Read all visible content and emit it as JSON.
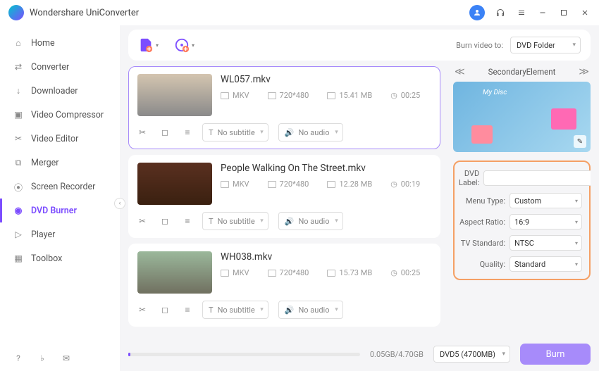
{
  "app": {
    "title": "Wondershare UniConverter"
  },
  "sidebar": {
    "items": [
      {
        "label": "Home",
        "icon": "home"
      },
      {
        "label": "Converter",
        "icon": "converter"
      },
      {
        "label": "Downloader",
        "icon": "download"
      },
      {
        "label": "Video Compressor",
        "icon": "compress"
      },
      {
        "label": "Video Editor",
        "icon": "edit"
      },
      {
        "label": "Merger",
        "icon": "merge"
      },
      {
        "label": "Screen Recorder",
        "icon": "record"
      },
      {
        "label": "DVD Burner",
        "icon": "dvd",
        "active": true
      },
      {
        "label": "Player",
        "icon": "play"
      },
      {
        "label": "Toolbox",
        "icon": "tools"
      }
    ]
  },
  "toolbar": {
    "burn_to_label": "Burn video to:",
    "burn_to_value": "DVD Folder"
  },
  "files": [
    {
      "name": "WL057.mkv",
      "format": "MKV",
      "res": "720*480",
      "size": "15.41 MB",
      "dur": "00:25",
      "subtitle": "No subtitle",
      "audio": "No audio"
    },
    {
      "name": "People Walking On The Street.mkv",
      "format": "MKV",
      "res": "720*480",
      "size": "12.28 MB",
      "dur": "00:19",
      "subtitle": "No subtitle",
      "audio": "No audio"
    },
    {
      "name": "WH038.mkv",
      "format": "MKV",
      "res": "720*480",
      "size": "15.73 MB",
      "dur": "00:25",
      "subtitle": "No subtitle",
      "audio": "No audio"
    }
  ],
  "template": {
    "name": "SecondaryElement",
    "preview_text": "My Disc"
  },
  "settings": {
    "dvd_label": {
      "label": "DVD Label:",
      "value": ""
    },
    "menu_type": {
      "label": "Menu Type:",
      "value": "Custom"
    },
    "aspect": {
      "label": "Aspect Ratio:",
      "value": "16:9"
    },
    "tv": {
      "label": "TV Standard:",
      "value": "NTSC"
    },
    "quality": {
      "label": "Quality:",
      "value": "Standard"
    }
  },
  "footer": {
    "size": "0.05GB/4.70GB",
    "disc": "DVD5 (4700MB)",
    "burn": "Burn"
  }
}
